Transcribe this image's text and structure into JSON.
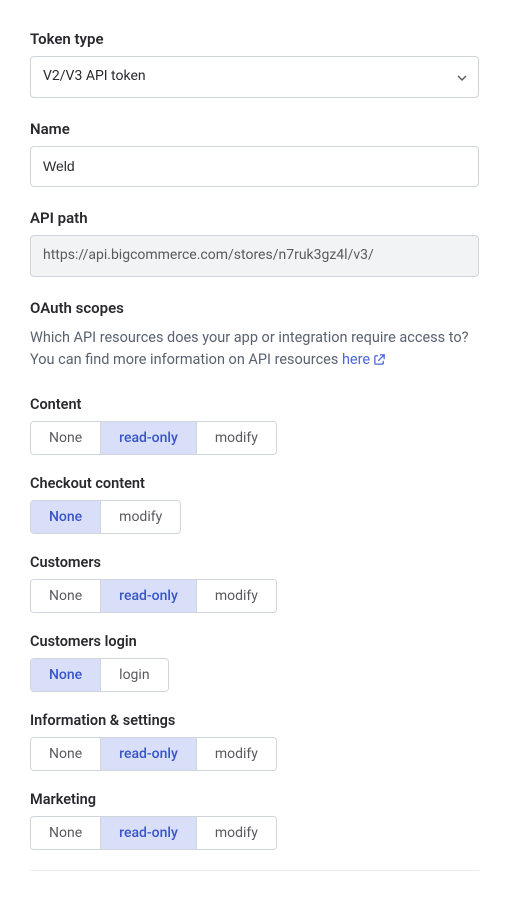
{
  "token_type": {
    "label": "Token type",
    "value": "V2/V3 API token"
  },
  "name": {
    "label": "Name",
    "value": "Weld"
  },
  "api_path": {
    "label": "API path",
    "value": "https://api.bigcommerce.com/stores/n7ruk3gz4l/v3/"
  },
  "oauth": {
    "heading": "OAuth scopes",
    "help_prefix": "Which API resources does your app or integration require access to? You can find more information on API resources ",
    "help_link_text": "here"
  },
  "scopes": [
    {
      "label": "Content",
      "options": [
        "None",
        "read-only",
        "modify"
      ],
      "selected": 1
    },
    {
      "label": "Checkout content",
      "options": [
        "None",
        "modify"
      ],
      "selected": 0
    },
    {
      "label": "Customers",
      "options": [
        "None",
        "read-only",
        "modify"
      ],
      "selected": 1
    },
    {
      "label": "Customers login",
      "options": [
        "None",
        "login"
      ],
      "selected": 0
    },
    {
      "label": "Information & settings",
      "options": [
        "None",
        "read-only",
        "modify"
      ],
      "selected": 1
    },
    {
      "label": "Marketing",
      "options": [
        "None",
        "read-only",
        "modify"
      ],
      "selected": 1
    }
  ]
}
